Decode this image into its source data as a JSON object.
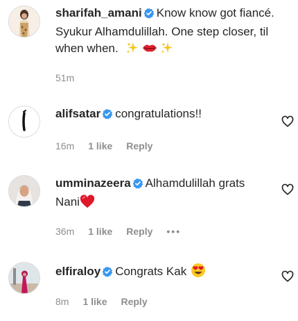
{
  "comments": [
    {
      "username": "sharifah_amani",
      "text": "Know know got fiancé. Syukur Alhamdulillah. One step closer, til when when.",
      "emojis": [
        "sparkles",
        "lips",
        "sparkles"
      ],
      "time": "51m"
    },
    {
      "username": "alifsatar",
      "text": "congratulations!!",
      "time": "16m",
      "likes": "1 like",
      "reply": "Reply"
    },
    {
      "username": "umminazeera",
      "text": "Alhamdulillah grats Nani",
      "emojis": [
        "red-heart"
      ],
      "time": "36m",
      "likes": "1 like",
      "reply": "Reply",
      "more": "•••"
    },
    {
      "username": "elfiraloy",
      "text": "Congrats Kak",
      "emojis": [
        "heart-eyes"
      ],
      "time": "8m",
      "likes": "1 like",
      "reply": "Reply"
    }
  ],
  "colors": {
    "verified": "#3897f0",
    "meta": "#8e8e8e",
    "text": "#262626"
  }
}
